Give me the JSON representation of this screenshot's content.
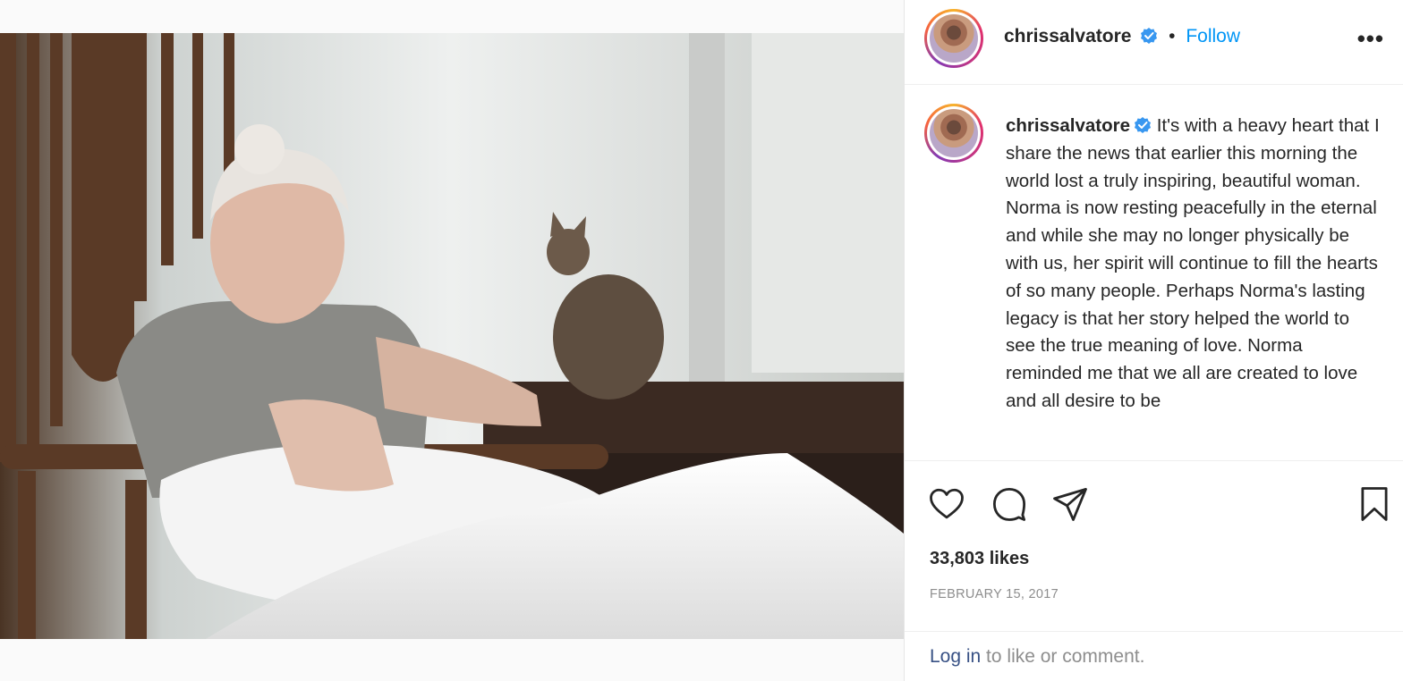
{
  "post": {
    "username": "chrissalvatore",
    "follow_label": "Follow",
    "separator": "•",
    "more_label": "•••",
    "caption": "It's with a heavy heart that I share the news that earlier this morning the world lost a truly inspiring, beautiful woman. Norma is now resting peacefully in the eternal and while she may no longer physically be with us, her spirit will continue to fill the hearts of so many people. Perhaps Norma's lasting legacy is that her story helped the world to see the true meaning of love. Norma reminded me that we all are created to love and all desire to be",
    "likes": "33,803 likes",
    "date": "FEBRUARY 15, 2017"
  },
  "login": {
    "link_label": "Log in",
    "rest": " to like or comment."
  },
  "colors": {
    "link_blue": "#0095f6",
    "verified_blue": "#3897f0",
    "muted": "#8e8e8e"
  },
  "icons": {
    "like": "heart-icon",
    "comment": "comment-icon",
    "share": "paper-plane-icon",
    "save": "bookmark-icon",
    "verified": "verified-badge-icon"
  }
}
